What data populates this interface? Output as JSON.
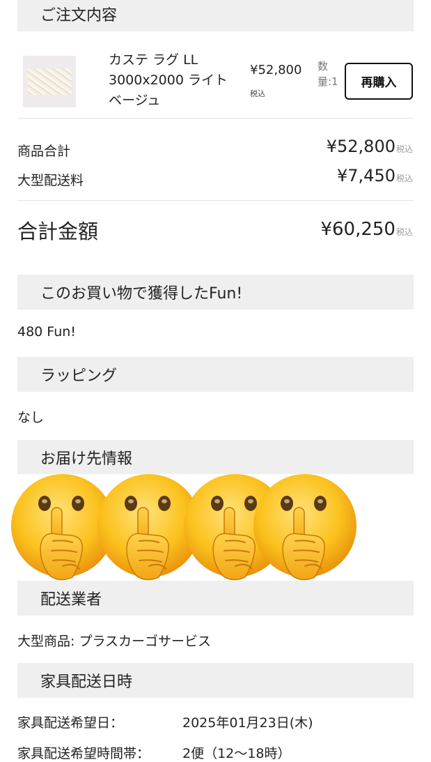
{
  "order": {
    "header": "ご注文内容",
    "item": {
      "name": "カステ ラグ LL 3000x2000 ライトベージュ",
      "price": "¥52,800",
      "tax_label": "税込",
      "qty_label": "数量:1",
      "rebuy_label": "再購入"
    }
  },
  "totals": {
    "subtotal_label": "商品合計",
    "subtotal_value": "¥52,800",
    "shipping_label": "大型配送料",
    "shipping_value": "¥7,450",
    "total_label": "合計金額",
    "total_value": "¥60,250",
    "tax_label": "税込"
  },
  "fun": {
    "header": "このお買い物で獲得したFun!",
    "value": "480 Fun!"
  },
  "wrapping": {
    "header": "ラッピング",
    "value": "なし"
  },
  "delivery_info": {
    "header": "お届け先情報",
    "emoji_name": "shushing-face-emoji",
    "emoji_count": 4
  },
  "carrier": {
    "header": "配送業者",
    "value": "大型商品: プラスカーゴサービス"
  },
  "furniture_delivery": {
    "header": "家具配送日時",
    "date_label": "家具配送希望日：",
    "date_value": "2025年01月23日(木)",
    "time_label": "家具配送希望時間帯：",
    "time_value": "2便（12〜18時）"
  }
}
